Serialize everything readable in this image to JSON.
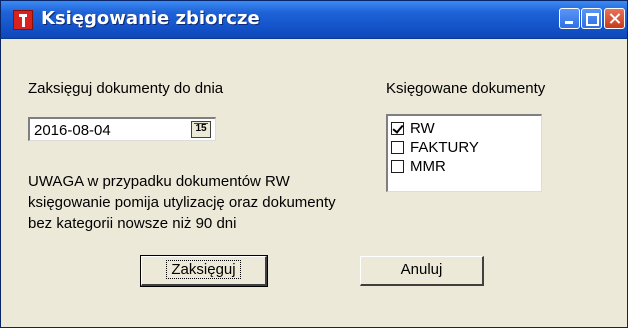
{
  "window": {
    "title": "Księgowanie zbiorcze",
    "controls": [
      "minimize-icon",
      "maximize-icon",
      "close-icon"
    ]
  },
  "date_section": {
    "label": "Zaksięguj dokumenty do dnia",
    "date_value": "2016-08-04",
    "calendar_button": "15"
  },
  "warning": {
    "line1": "UWAGA w przypadku dokumentów RW",
    "line2": "księgowanie pomija utylizację oraz dokumenty",
    "line3": "bez kategorii nowsze niż 90 dni"
  },
  "documents": {
    "label": "Księgowane dokumenty",
    "items": [
      {
        "label": "RW",
        "checked": true
      },
      {
        "label": "FAKTURY",
        "checked": false
      },
      {
        "label": "MMR",
        "checked": false
      }
    ]
  },
  "buttons": {
    "post": "Zaksięguj",
    "cancel": "Anuluj"
  },
  "colors": {
    "title_bar": "#1453c9",
    "window_bg": "#ece9d8",
    "close_button": "#c9391a"
  }
}
